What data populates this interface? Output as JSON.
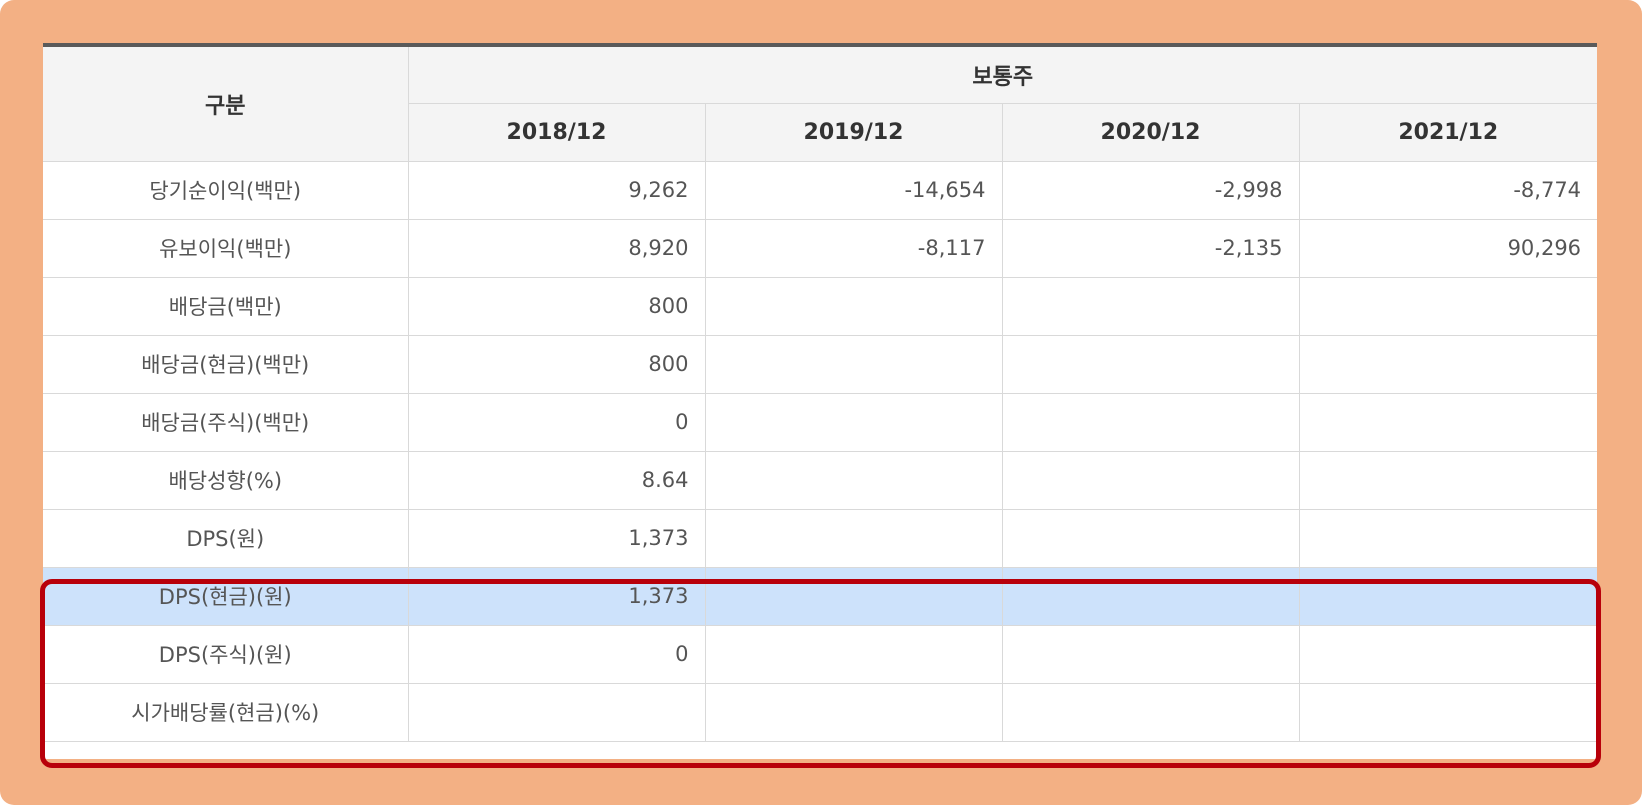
{
  "colors": {
    "frame_background": "#f3b084",
    "header_background": "#f4f4f4",
    "selected_row": "#cde2fb",
    "highlight_border": "#b8000a",
    "top_rule": "#5a5a5a"
  },
  "table": {
    "category_header": "구분",
    "group_header": "보통주",
    "periods": [
      "2018/12",
      "2019/12",
      "2020/12",
      "2021/12"
    ],
    "rows": [
      {
        "label": "당기순이익(백만)",
        "values": [
          "9,262",
          "-14,654",
          "-2,998",
          "-8,774"
        ]
      },
      {
        "label": "유보이익(백만)",
        "values": [
          "8,920",
          "-8,117",
          "-2,135",
          "90,296"
        ]
      },
      {
        "label": "배당금(백만)",
        "values": [
          "800",
          "",
          "",
          ""
        ]
      },
      {
        "label": "배당금(현금)(백만)",
        "values": [
          "800",
          "",
          "",
          ""
        ]
      },
      {
        "label": "배당금(주식)(백만)",
        "values": [
          "0",
          "",
          "",
          ""
        ]
      },
      {
        "label": "배당성향(%)",
        "values": [
          "8.64",
          "",
          "",
          ""
        ]
      },
      {
        "label": "DPS(원)",
        "values": [
          "1,373",
          "",
          "",
          ""
        ]
      },
      {
        "label": "DPS(현금)(원)",
        "values": [
          "1,373",
          "",
          "",
          ""
        ]
      },
      {
        "label": "DPS(주식)(원)",
        "values": [
          "0",
          "",
          "",
          ""
        ]
      },
      {
        "label": "시가배당률(현금)(%)",
        "values": [
          "",
          "",
          "",
          ""
        ]
      }
    ],
    "selected_row_label": "DPS(현금)(원)"
  }
}
